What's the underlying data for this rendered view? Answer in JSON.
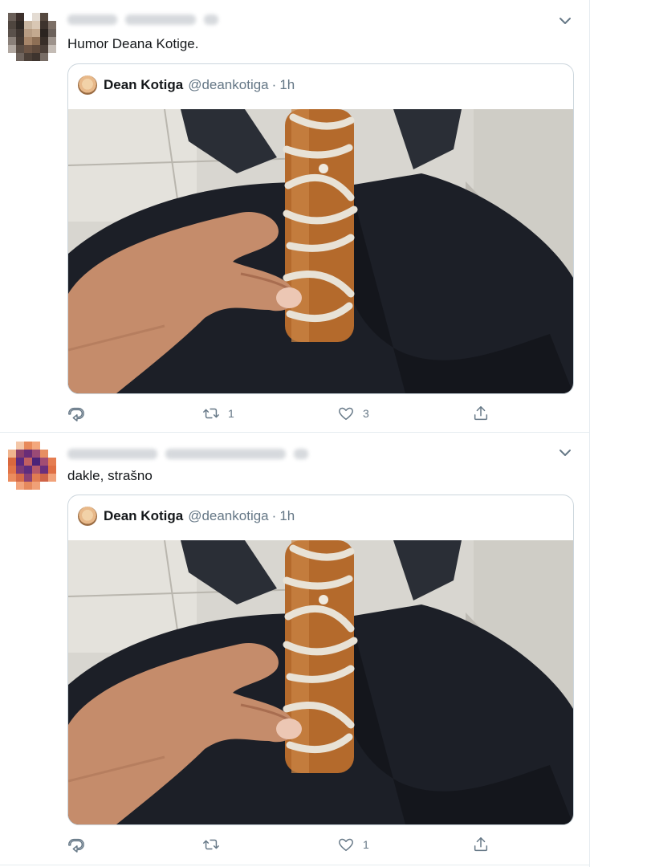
{
  "tweets": [
    {
      "text": "Humor Deana Kotige.",
      "quoted": {
        "name": "Dean Kotiga",
        "handle": "@deankotiga",
        "separator": "·",
        "time": "1h"
      },
      "actions": {
        "reply_count": "",
        "retweet_count": "1",
        "like_count": "3"
      }
    },
    {
      "text": "dakle, strašno",
      "quoted": {
        "name": "Dean Kotiga",
        "handle": "@deankotiga",
        "separator": "·",
        "time": "1h"
      },
      "actions": {
        "reply_count": "",
        "retweet_count": "",
        "like_count": "1"
      }
    }
  ],
  "icons": {
    "reply": "reply-icon",
    "retweet": "retweet-icon",
    "like": "heart-icon",
    "share": "share-icon",
    "caret": "chevron-down-icon"
  },
  "colors": {
    "text": "#14171a",
    "secondary": "#657786",
    "border": "#ccd6dd",
    "divider": "#e6ecf0"
  }
}
